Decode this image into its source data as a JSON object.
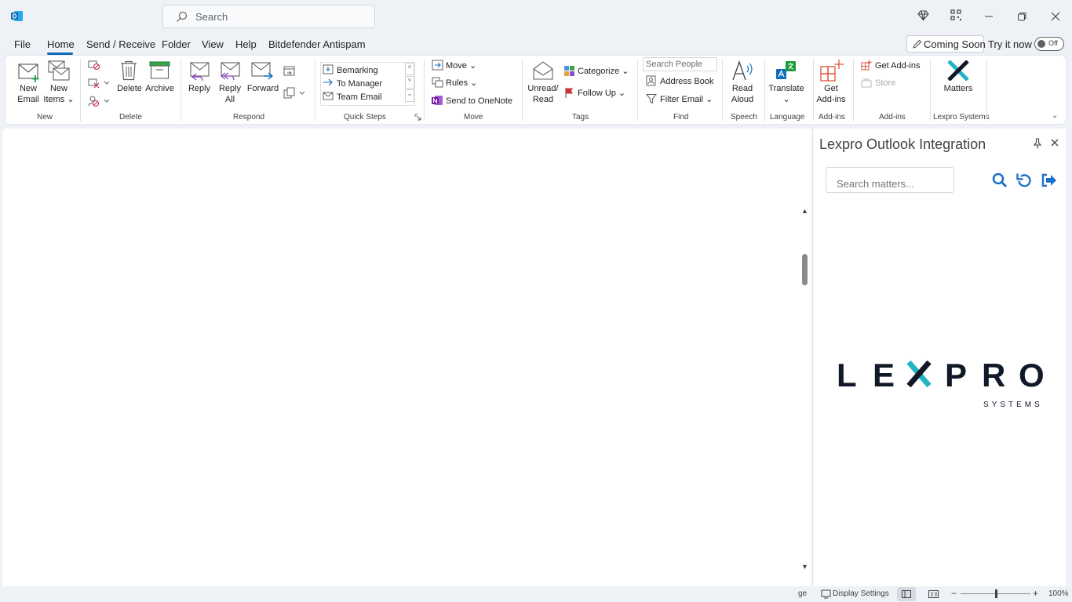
{
  "titlebar": {
    "search_placeholder": "Search"
  },
  "menu": {
    "tabs": [
      "File",
      "Home",
      "Send / Receive",
      "Folder",
      "View",
      "Help",
      "Bitdefender Antispam"
    ],
    "active_tab": "Home",
    "coming_soon": "Coming Soon",
    "try_it_now": "Try it now",
    "toggle_state": "Off"
  },
  "ribbon": {
    "new": {
      "new_email": [
        "New",
        "Email"
      ],
      "new_items": [
        "New",
        "Items"
      ],
      "label": "New"
    },
    "delete": {
      "delete": "Delete",
      "archive": "Archive",
      "label": "Delete"
    },
    "respond": {
      "reply": "Reply",
      "reply_all": [
        "Reply",
        "All"
      ],
      "forward": "Forward",
      "label": "Respond"
    },
    "quick_steps": {
      "items": [
        "Bemarking",
        "To Manager",
        "Team Email"
      ],
      "label": "Quick Steps"
    },
    "move": {
      "move": "Move",
      "rules": "Rules",
      "onenote": "Send to OneNote",
      "label": "Move"
    },
    "tags": {
      "unread_read": [
        "Unread/",
        "Read"
      ],
      "categorize": "Categorize",
      "follow_up": "Follow Up",
      "label": "Tags"
    },
    "find": {
      "search_people": "Search People",
      "address_book": "Address Book",
      "filter_email": "Filter Email",
      "label": "Find"
    },
    "speech": {
      "read_aloud": [
        "Read",
        "Aloud"
      ],
      "label": "Speech"
    },
    "language": {
      "translate": "Translate",
      "label": "Language"
    },
    "addins1": {
      "get_addins": [
        "Get",
        "Add-ins"
      ],
      "label": "Add-ins"
    },
    "addins2": {
      "get_addins": "Get Add-ins",
      "store": "Store",
      "label": "Add-ins"
    },
    "lexpro": {
      "matters": "Matters",
      "label": "Lexpro Systems"
    }
  },
  "pane": {
    "title": "Lexpro Outlook Integration",
    "search_placeholder": "Search matters...",
    "logo_word": "LEXPRO",
    "logo_sub": "SYSTEMS"
  },
  "statusbar": {
    "display_settings": "Display Settings",
    "zoom": "100%",
    "zoom_level": 0.5
  },
  "colors": {
    "accent": "#0f6cbd",
    "lexpro_teal": "#23b4c4",
    "lexpro_dark": "#111827"
  }
}
